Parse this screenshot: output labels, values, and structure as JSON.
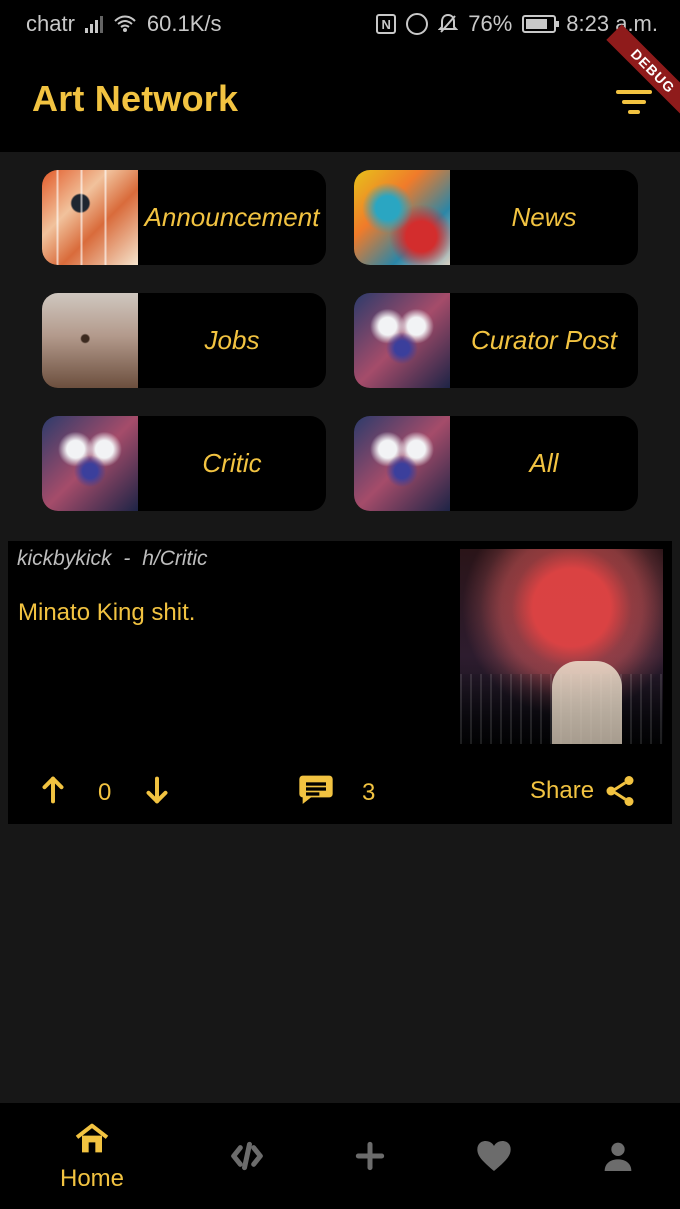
{
  "status_bar": {
    "carrier": "chatr",
    "speed": "60.1K/s",
    "battery": "76%",
    "time": "8:23 a.m."
  },
  "app": {
    "title": "Art Network",
    "debug_badge": "DEBUG",
    "accent": "#f2c341"
  },
  "categories": [
    {
      "label": "Announcement",
      "thumb": "abstract-wood-art"
    },
    {
      "label": "News",
      "thumb": "colorful-paint-splash"
    },
    {
      "label": "Jobs",
      "thumb": "horse-rider-desert"
    },
    {
      "label": "Curator Post",
      "thumb": "butterfly-face-portrait"
    },
    {
      "label": "Critic",
      "thumb": "butterfly-face-portrait"
    },
    {
      "label": "All",
      "thumb": "butterfly-face-portrait"
    }
  ],
  "post": {
    "author": "kickbykick",
    "separator": "-",
    "community": "h/Critic",
    "title": "Minato King shit.",
    "score": "0",
    "comments": "3",
    "share_label": "Share",
    "image": "anime-red-sky-city"
  },
  "bottom_nav": {
    "items": [
      {
        "label": "Home",
        "icon": "home-icon"
      },
      {
        "label": "",
        "icon": "code-icon"
      },
      {
        "label": "",
        "icon": "plus-icon"
      },
      {
        "label": "",
        "icon": "heart-icon"
      },
      {
        "label": "",
        "icon": "profile-icon"
      }
    ]
  }
}
